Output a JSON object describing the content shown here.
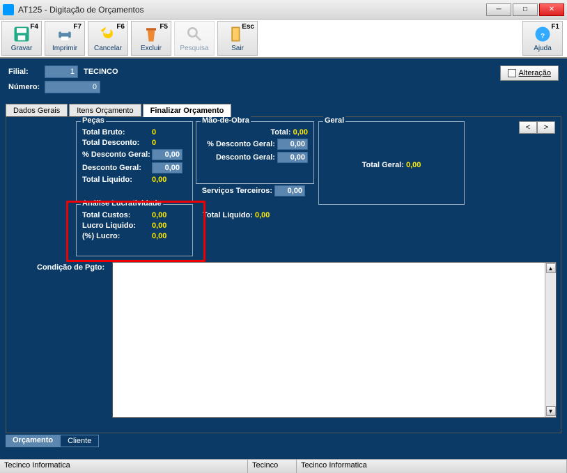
{
  "window": {
    "title": "AT125 - Digitação de Orçamentos"
  },
  "toolbar": {
    "gravar": {
      "label": "Gravar",
      "fkey": "F4"
    },
    "imprimir": {
      "label": "Imprimir",
      "fkey": "F7"
    },
    "cancelar": {
      "label": "Cancelar",
      "fkey": "F6"
    },
    "excluir": {
      "label": "Excluir",
      "fkey": "F5"
    },
    "pesquisa": {
      "label": "Pesquisa",
      "fkey": ""
    },
    "sair": {
      "label": "Sair",
      "fkey": "Esc"
    },
    "ajuda": {
      "label": "Ajuda",
      "fkey": "F1"
    }
  },
  "header": {
    "filial_label": "Filial:",
    "filial_value": "1",
    "filial_name": "TECINCO",
    "numero_label": "Número:",
    "numero_value": "0",
    "alteracao_label": "Alteração"
  },
  "tabs": {
    "dados": "Dados Gerais",
    "itens": "Itens Orçamento",
    "finalizar": "Finalizar Orçamento"
  },
  "nav": {
    "prev": "<",
    "next": ">"
  },
  "pecas": {
    "legend": "Peças",
    "total_bruto_l": "Total Bruto:",
    "total_bruto_v": "0",
    "total_desc_l": "Total Desconto:",
    "total_desc_v": "0",
    "pct_desc_l": "% Desconto Geral:",
    "pct_desc_v": "0,00",
    "desc_geral_l": "Desconto Geral:",
    "desc_geral_v": "0,00",
    "total_liq_l": "Total Liquido:",
    "total_liq_v": "0,00"
  },
  "mao": {
    "legend": "Mão-de-Obra",
    "total_l": "Total:",
    "total_v": "0,00",
    "pct_desc_l": "% Desconto Geral:",
    "pct_desc_v": "0,00",
    "desc_geral_l": "Desconto Geral:",
    "desc_geral_v": "0,00",
    "serv_terc_l": "Serviços Terceiros:",
    "serv_terc_v": "0,00",
    "total_liq_l": "Total Liquido:",
    "total_liq_v": "0,00"
  },
  "geral": {
    "legend": "Geral",
    "total_geral_l": "Total Geral:",
    "total_geral_v": "0,00"
  },
  "analise": {
    "legend": "Análise Lucratividade",
    "custos_l": "Total Custos:",
    "custos_v": "0,00",
    "lucro_l": "Lucro Liquido:",
    "lucro_v": "0,00",
    "pct_l": "(%) Lucro:",
    "pct_v": "0,00"
  },
  "cond_label": "Condição de Pgto:",
  "bottom_tabs": {
    "orcamento": "Orçamento",
    "cliente": "Cliente"
  },
  "status": {
    "c1": "Tecinco Informatica",
    "c2": "Tecinco",
    "c3": "Tecinco Informatica"
  }
}
